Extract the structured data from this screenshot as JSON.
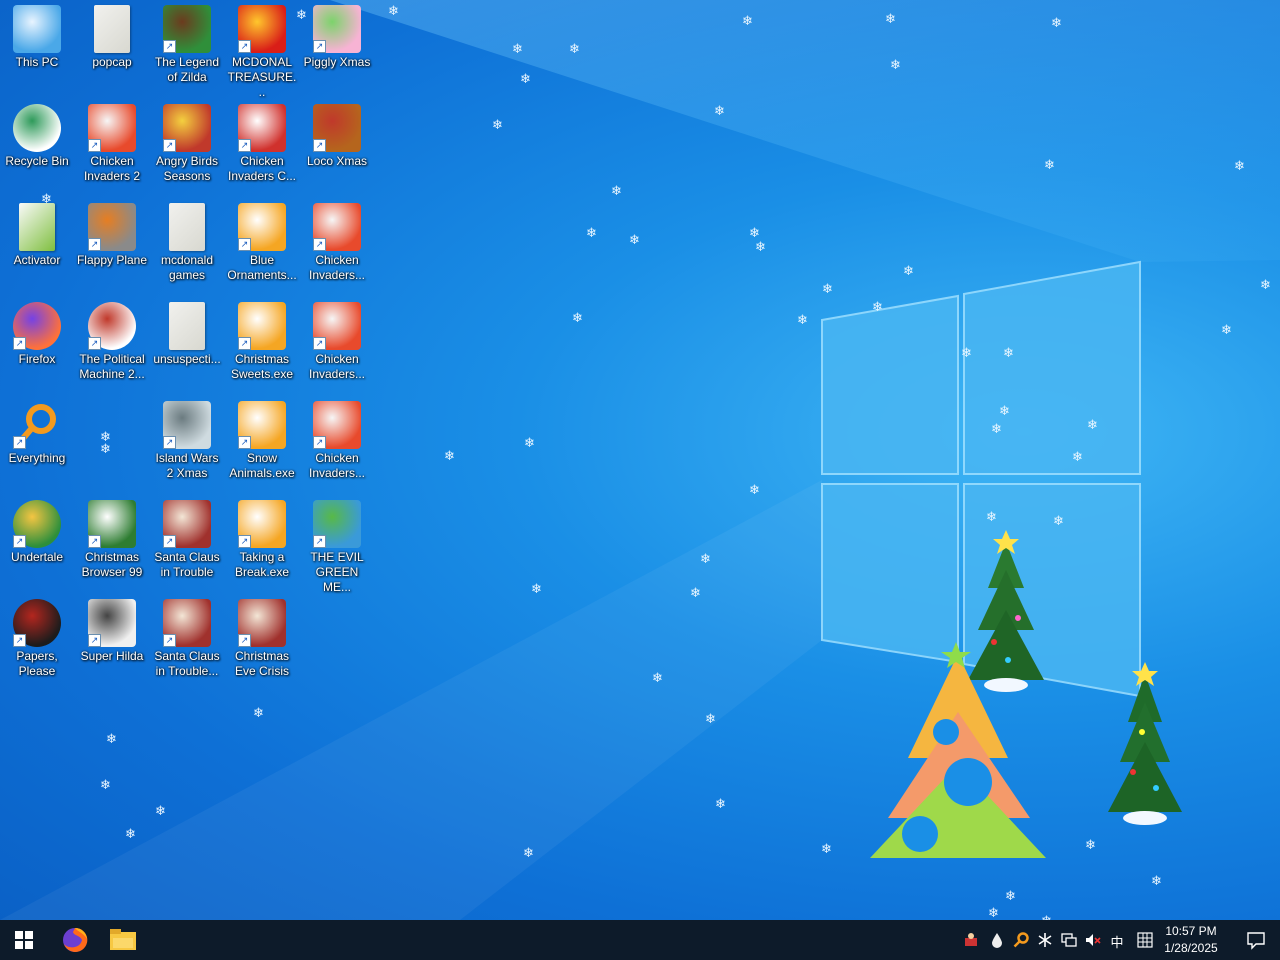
{
  "desktop": {
    "icons": [
      {
        "label": "This PC",
        "icon": "computer-icon"
      },
      {
        "label": "popcap",
        "icon": "folder-icon"
      },
      {
        "label": "The Legend of Zilda",
        "icon": "game-icon"
      },
      {
        "label": "MCDONAL TREASURE...",
        "icon": "mcdonalds-icon"
      },
      {
        "label": "Piggly Xmas",
        "icon": "pig-icon"
      },
      {
        "label": "Recycle Bin",
        "icon": "recycle-bin-icon"
      },
      {
        "label": "Chicken Invaders 2",
        "icon": "chicken-icon"
      },
      {
        "label": "Angry Birds Seasons",
        "icon": "angry-birds-icon"
      },
      {
        "label": "Chicken Invaders C...",
        "icon": "snowman-icon"
      },
      {
        "label": "Loco Xmas",
        "icon": "bear-icon"
      },
      {
        "label": "Activator",
        "icon": "file-icon"
      },
      {
        "label": "Flappy Plane",
        "icon": "plane-icon"
      },
      {
        "label": "mcdonald games",
        "icon": "folder-icon"
      },
      {
        "label": "Blue Ornaments...",
        "icon": "installer-icon"
      },
      {
        "label": "Chicken Invaders...",
        "icon": "chicken-icon"
      },
      {
        "label": "Firefox",
        "icon": "firefox-icon"
      },
      {
        "label": "The Political Machine 2...",
        "icon": "election-icon"
      },
      {
        "label": "unsuspecti...",
        "icon": "folder-icon"
      },
      {
        "label": "Christmas Sweets.exe",
        "icon": "installer-icon"
      },
      {
        "label": "Chicken Invaders...",
        "icon": "chicken-icon"
      },
      {
        "label": "Everything",
        "icon": "search-magnifier-icon"
      },
      {
        "label": "Island Wars 2 Xmas",
        "icon": "ship-icon"
      },
      {
        "label": "Snow Animals.exe",
        "icon": "installer-icon"
      },
      {
        "label": "Chicken Invaders...",
        "icon": "chicken-icon"
      },
      {
        "label": "Undertale",
        "icon": "undertale-icon"
      },
      {
        "label": "Christmas Browser 99",
        "icon": "xmas-tree-icon"
      },
      {
        "label": "Santa Claus in Trouble",
        "icon": "santa-icon"
      },
      {
        "label": "Taking a Break.exe",
        "icon": "installer-icon"
      },
      {
        "label": "THE EVIL GREEN ME...",
        "icon": "messenger-icon"
      },
      {
        "label": "Papers, Please",
        "icon": "papers-icon"
      },
      {
        "label": "Super Hilda",
        "icon": "pixel-icon"
      },
      {
        "label": "Santa Claus in Trouble...",
        "icon": "santa-icon"
      },
      {
        "label": "Christmas Eve Crisis",
        "icon": "santa-icon"
      }
    ]
  },
  "taskbar": {
    "start_icon": "windows-start-icon",
    "pinned": [
      {
        "name": "firefox",
        "icon": "firefox-icon"
      },
      {
        "name": "file-explorer",
        "icon": "folder-icon"
      }
    ],
    "tray": {
      "ime": "中",
      "time": "10:57 PM",
      "date": "1/28/2025"
    }
  },
  "colors": {
    "accent": "#0e70d6",
    "taskbar": "#0d1b2a"
  }
}
